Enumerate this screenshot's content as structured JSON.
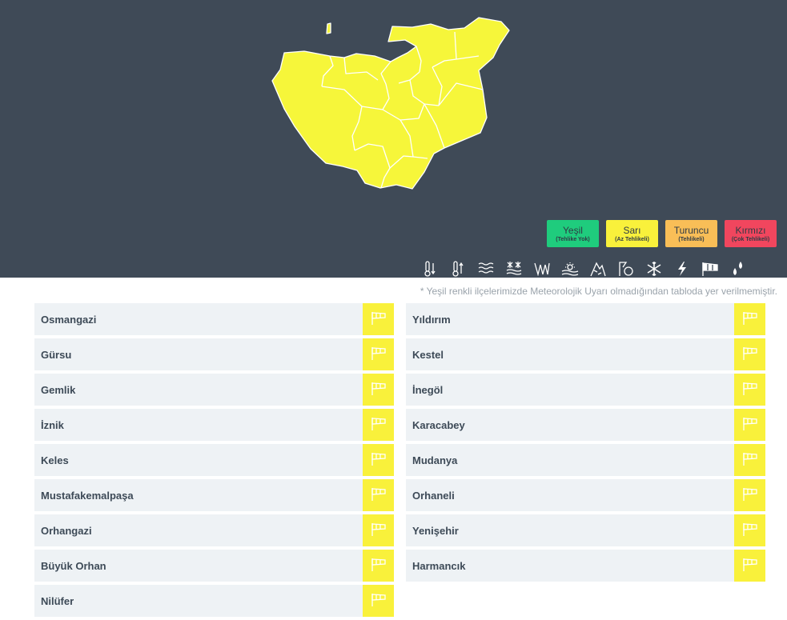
{
  "colors": {
    "panel_bg": "#3f4a57",
    "map_fill": "#f6f63a",
    "map_border": "#ffffff",
    "green": "#1fcc7d",
    "yellow": "#f9f13b",
    "orange": "#f9be57",
    "red": "#f1465e",
    "row_bg": "#eef2f5"
  },
  "legend": [
    {
      "label": "Yeşil",
      "sub": "(Tehlike Yok)",
      "color": "green"
    },
    {
      "label": "Sarı",
      "sub": "(Az Tehlikeli)",
      "color": "yellow"
    },
    {
      "label": "Turuncu",
      "sub": "(Tehlikeli)",
      "color": "orange"
    },
    {
      "label": "Kırmızı",
      "sub": "(Çok Tehlikeli)",
      "color": "red"
    }
  ],
  "hazard_icons": [
    "cold-thermometer-icon",
    "hot-thermometer-icon",
    "fog-icon",
    "snow-rain-icon",
    "rain-icon",
    "dust-icon",
    "avalanche-icon",
    "ice-icon",
    "snow-icon",
    "lightning-icon",
    "wind-icon",
    "rain-drop-icon"
  ],
  "note": "* Yeşil renkli ilçelerimizde Meteorolojik Uyarı olmadığından tabloda yer verilmemiştir.",
  "districts_left": [
    {
      "name": "Osmangazi"
    },
    {
      "name": "Gürsu"
    },
    {
      "name": "Gemlik"
    },
    {
      "name": "İznik"
    },
    {
      "name": "Keles"
    },
    {
      "name": "Mustafakemalpaşa"
    },
    {
      "name": "Orhangazi"
    },
    {
      "name": "Büyük Orhan"
    },
    {
      "name": "Nilüfer"
    }
  ],
  "districts_right": [
    {
      "name": "Yıldırım"
    },
    {
      "name": "Kestel"
    },
    {
      "name": "İnegöl"
    },
    {
      "name": "Karacabey"
    },
    {
      "name": "Mudanya"
    },
    {
      "name": "Orhaneli"
    },
    {
      "name": "Yenişehir"
    },
    {
      "name": "Harmancık"
    }
  ],
  "warning_icon": "wind-icon"
}
